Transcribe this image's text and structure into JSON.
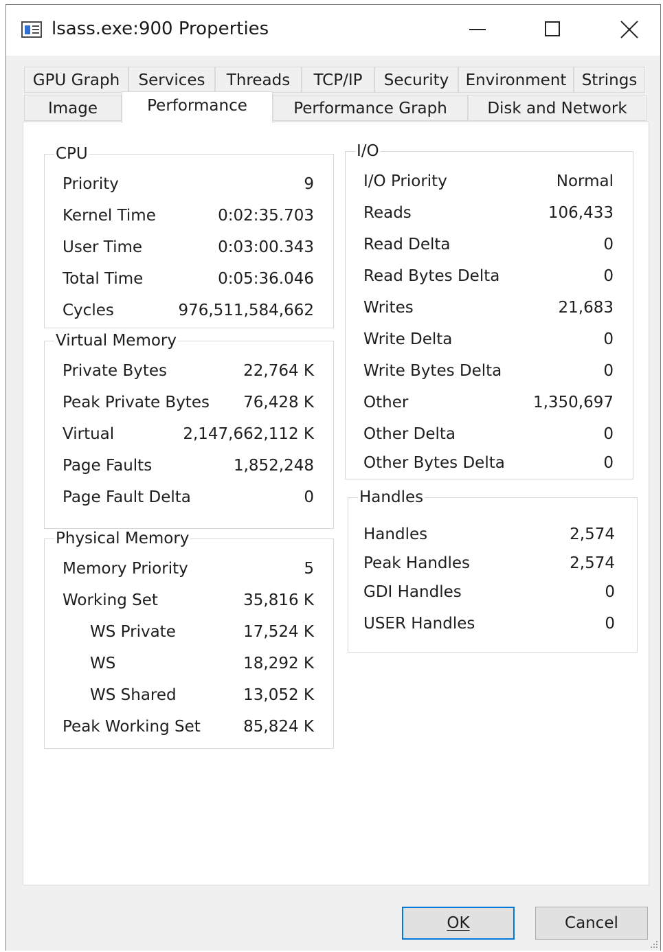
{
  "window": {
    "title": "lsass.exe:900 Properties"
  },
  "tabs_row1": [
    "GPU Graph",
    "Services",
    "Threads",
    "TCP/IP",
    "Security",
    "Environment",
    "Strings"
  ],
  "tabs_row2": [
    "Image",
    "Performance",
    "Performance Graph",
    "Disk and Network"
  ],
  "active_tab": "Performance",
  "cpu": {
    "title": "CPU",
    "rows": [
      {
        "label": "Priority",
        "value": "9"
      },
      {
        "label": "Kernel Time",
        "value": "0:02:35.703"
      },
      {
        "label": "User Time",
        "value": "0:03:00.343"
      },
      {
        "label": "Total Time",
        "value": "0:05:36.046"
      },
      {
        "label": "Cycles",
        "value": "976,511,584,662"
      }
    ]
  },
  "virtual_memory": {
    "title": "Virtual Memory",
    "rows": [
      {
        "label": "Private Bytes",
        "value": "22,764 K"
      },
      {
        "label": "Peak Private Bytes",
        "value": "76,428 K"
      },
      {
        "label": "Virtual",
        "value": "2,147,662,112 K"
      },
      {
        "label": "Page Faults",
        "value": "1,852,248"
      },
      {
        "label": "Page Fault Delta",
        "value": "0"
      }
    ]
  },
  "physical_memory": {
    "title": "Physical Memory",
    "rows": [
      {
        "label": "Memory Priority",
        "value": "5"
      },
      {
        "label": "Working Set",
        "value": "35,816 K"
      },
      {
        "label": "WS Private",
        "value": "17,524 K"
      },
      {
        "label": "WS",
        "value": "18,292 K"
      },
      {
        "label": "WS Shared",
        "value": "13,052 K"
      },
      {
        "label": "Peak Working Set",
        "value": "85,824 K"
      }
    ]
  },
  "io": {
    "title": "I/O",
    "rows": [
      {
        "label": "I/O Priority",
        "value": "Normal"
      },
      {
        "label": "Reads",
        "value": "106,433"
      },
      {
        "label": "Read Delta",
        "value": "0"
      },
      {
        "label": "Read Bytes Delta",
        "value": "0"
      },
      {
        "label": "Writes",
        "value": "21,683"
      },
      {
        "label": "Write Delta",
        "value": "0"
      },
      {
        "label": "Write Bytes Delta",
        "value": "0"
      },
      {
        "label": "Other",
        "value": "1,350,697"
      },
      {
        "label": "Other Delta",
        "value": "0"
      },
      {
        "label": "Other Bytes Delta",
        "value": "0"
      }
    ]
  },
  "handles": {
    "title": "Handles",
    "rows": [
      {
        "label": "Handles",
        "value": "2,574"
      },
      {
        "label": "Peak Handles",
        "value": "2,574"
      },
      {
        "label": "GDI Handles",
        "value": "0"
      },
      {
        "label": "USER Handles",
        "value": "0"
      }
    ]
  },
  "buttons": {
    "ok": "OK",
    "cancel": "Cancel"
  },
  "colors": {
    "default_button_border": "#0078d7",
    "window_bg": "#f0f0f0",
    "panel_bg": "#ffffff"
  }
}
